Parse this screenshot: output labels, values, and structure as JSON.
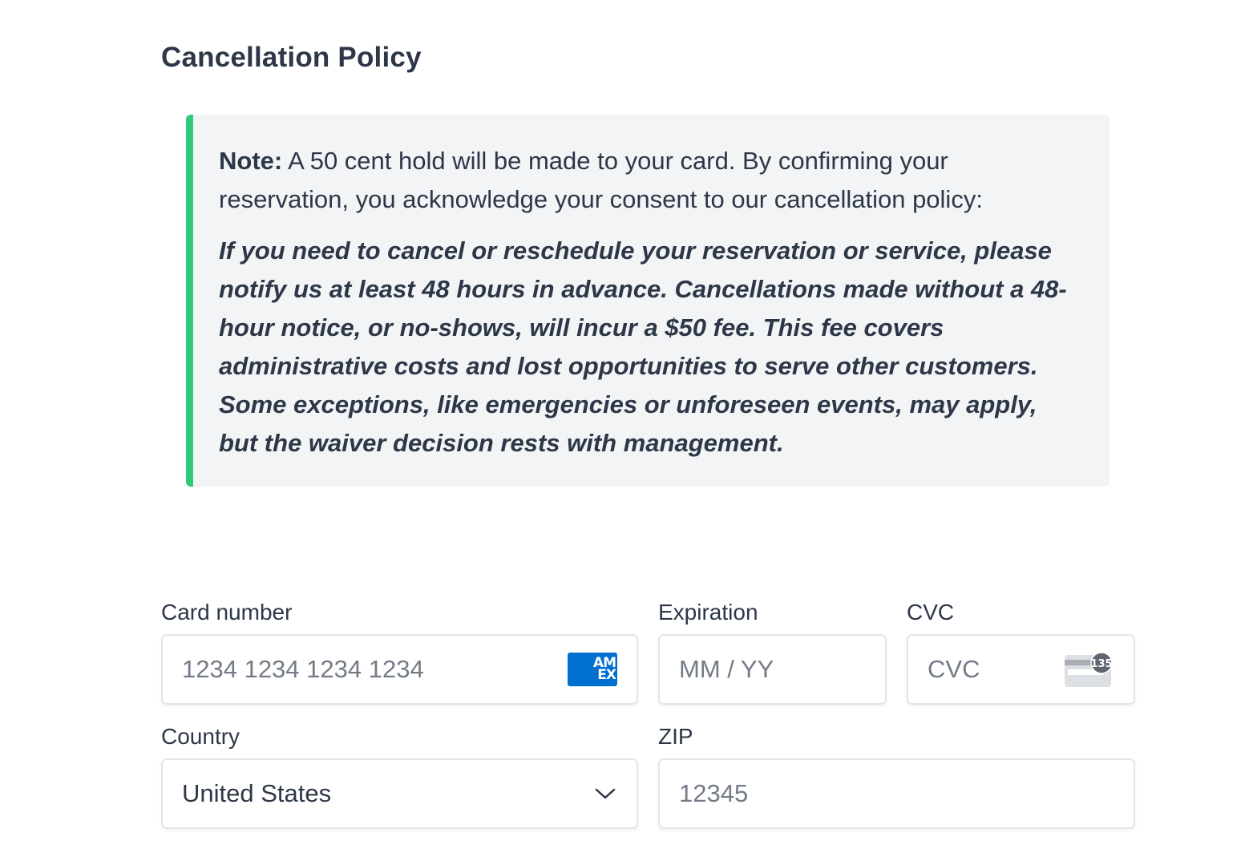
{
  "section": {
    "title": "Cancellation Policy"
  },
  "note": {
    "label": "Note:",
    "intro": " A 50 cent hold will be made to your card. By confirming your reservation, you acknowledge your consent to our cancellation policy:",
    "policy": "If you need to cancel or reschedule your reservation or service, please notify us at least 48 hours in advance. Cancellations made without a 48-hour notice, or no-shows, will incur a $50 fee. This fee covers administrative costs and lost opportunities to serve other customers. Some exceptions, like emergencies or unforeseen events, may apply, but the waiver decision rests with management.",
    "accent_color": "#2ecc7a",
    "background_color": "#f2f4f6"
  },
  "payment": {
    "card_number": {
      "label": "Card number",
      "placeholder": "1234 1234 1234 1234",
      "value": "",
      "brand_icon": "amex-icon",
      "brand_text": "AMEX"
    },
    "expiration": {
      "label": "Expiration",
      "placeholder": "MM / YY",
      "value": ""
    },
    "cvc": {
      "label": "CVC",
      "placeholder": "CVC",
      "value": "",
      "icon": "cvc-card-icon",
      "icon_badge": "135"
    },
    "country": {
      "label": "Country",
      "selected": "United States"
    },
    "zip": {
      "label": "ZIP",
      "placeholder": "12345",
      "value": ""
    }
  }
}
